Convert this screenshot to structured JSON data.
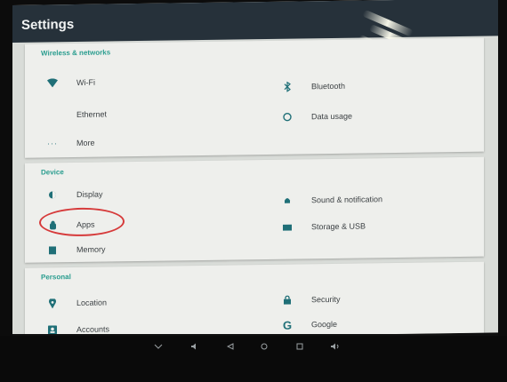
{
  "header": {
    "title": "Settings"
  },
  "sections": {
    "wireless": {
      "header": "Wireless & networks",
      "items": {
        "wifi": "Wi-Fi",
        "bluetooth": "Bluetooth",
        "ethernet": "Ethernet",
        "data_usage": "Data usage",
        "more": "More"
      }
    },
    "device": {
      "header": "Device",
      "items": {
        "display": "Display",
        "sound": "Sound & notification",
        "apps": "Apps",
        "storage": "Storage & USB",
        "memory": "Memory"
      }
    },
    "personal": {
      "header": "Personal",
      "items": {
        "location": "Location",
        "security": "Security",
        "accounts": "Accounts",
        "google": "Google"
      }
    }
  },
  "colors": {
    "title_bar": "#26313a",
    "accent": "#2a9d8f",
    "highlight_ring": "#d63a3a"
  },
  "icons": {
    "wifi": "wifi-icon",
    "bluetooth": "bluetooth-icon",
    "data_usage": "data-usage-icon",
    "more": "more-dots-icon",
    "display": "display-brightness-icon",
    "sound": "sound-bell-icon",
    "apps": "android-apps-icon",
    "storage": "storage-icon",
    "memory": "memory-icon",
    "location": "location-pin-icon",
    "security": "lock-icon",
    "accounts": "account-icon",
    "google": "google-g-icon"
  }
}
